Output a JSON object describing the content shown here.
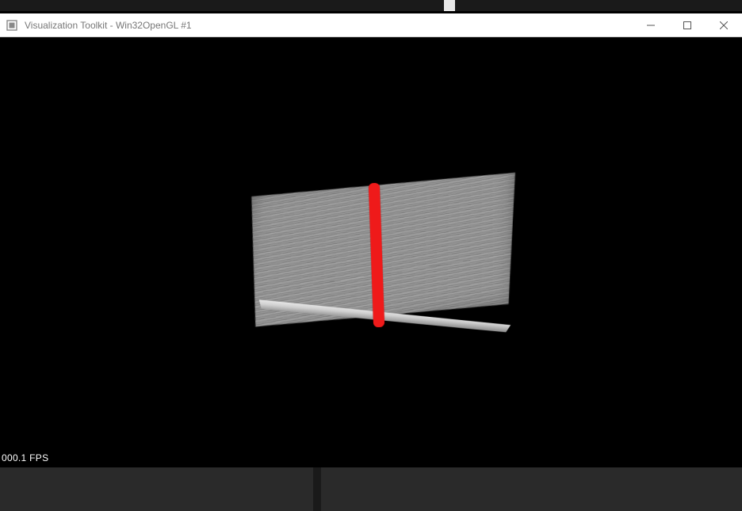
{
  "window": {
    "title": "Visualization Toolkit - Win32OpenGL #1"
  },
  "viewport": {
    "fps_label": "000.1 FPS"
  },
  "scene": {
    "surface_description": "grey-textured-surface",
    "marker_color": "#ef1a1a"
  }
}
